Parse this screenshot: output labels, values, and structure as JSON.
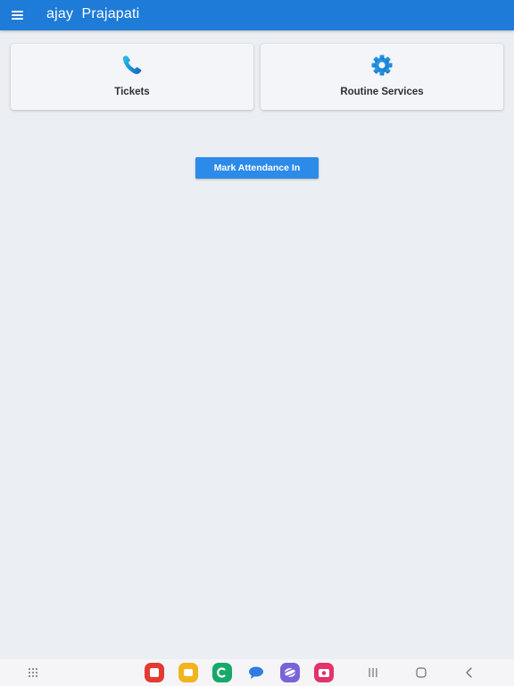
{
  "appbar": {
    "title": "ajay  Prajapati",
    "menu_icon": "hamburger-menu-icon"
  },
  "tiles": [
    {
      "label": "Tickets",
      "icon": "phone-icon",
      "icon_color": "#1aa0e0"
    },
    {
      "label": "Routine Services",
      "icon": "gear-icon",
      "icon_color": "#1e8fe0"
    }
  ],
  "actions": {
    "mark_attendance_label": "Mark Attendance In"
  },
  "colors": {
    "appbar": "#1e7bd8",
    "background": "#ebeef2",
    "button": "#2c8ae8"
  },
  "system_nav": {
    "apps_grid_icon": "apps-grid-icon",
    "dock_apps": [
      {
        "icon": "flipboard-app-icon",
        "color": "#e23b34"
      },
      {
        "icon": "folder-app-icon",
        "color": "#f1b41c"
      },
      {
        "icon": "phone-app-icon",
        "color": "#17a86a"
      },
      {
        "icon": "messages-app-icon",
        "color": "#2f7de1"
      },
      {
        "icon": "internet-app-icon",
        "color": "#7a63d8"
      },
      {
        "icon": "camera-app-icon",
        "color": "#e2336b"
      }
    ],
    "recents_icon": "recents-icon",
    "home_icon": "home-icon",
    "back_icon": "back-icon"
  }
}
